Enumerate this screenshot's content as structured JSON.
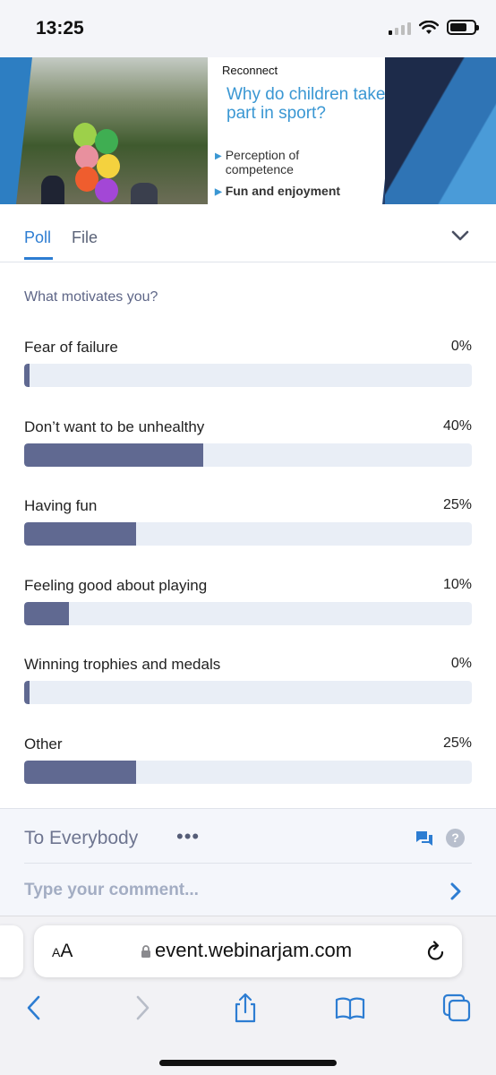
{
  "status_bar": {
    "time": "13:25"
  },
  "banner": {
    "slide_heading": "Reconnect",
    "slide_title": "Why do children take part in sport?",
    "bullets": [
      "Perception of competence",
      "Fun and enjoyment"
    ]
  },
  "tabs": [
    {
      "label": "Poll",
      "active": true
    },
    {
      "label": "File",
      "active": false
    }
  ],
  "poll": {
    "question": "What motivates you?",
    "options": [
      {
        "label": "Fear of failure",
        "percent_label": "0%",
        "fraction": 0.0
      },
      {
        "label": "Don’t want to be unhealthy",
        "percent_label": "40%",
        "fraction": 0.4
      },
      {
        "label": "Having fun",
        "percent_label": "25%",
        "fraction": 0.25
      },
      {
        "label": "Feeling good about playing",
        "percent_label": "10%",
        "fraction": 0.1
      },
      {
        "label": "Winning trophies and medals",
        "percent_label": "0%",
        "fraction": 0.0
      },
      {
        "label": "Other",
        "percent_label": "25%",
        "fraction": 0.25
      }
    ]
  },
  "chat": {
    "recipient": "To Everybody",
    "more_label": "•••",
    "comment_placeholder": "Type your comment..."
  },
  "browser": {
    "text_size_label": "AA",
    "url": "event.webinarjam.com"
  },
  "colors": {
    "accent": "#2d7dd2",
    "bar_fill": "#606991",
    "bar_track": "#e9eef6"
  }
}
